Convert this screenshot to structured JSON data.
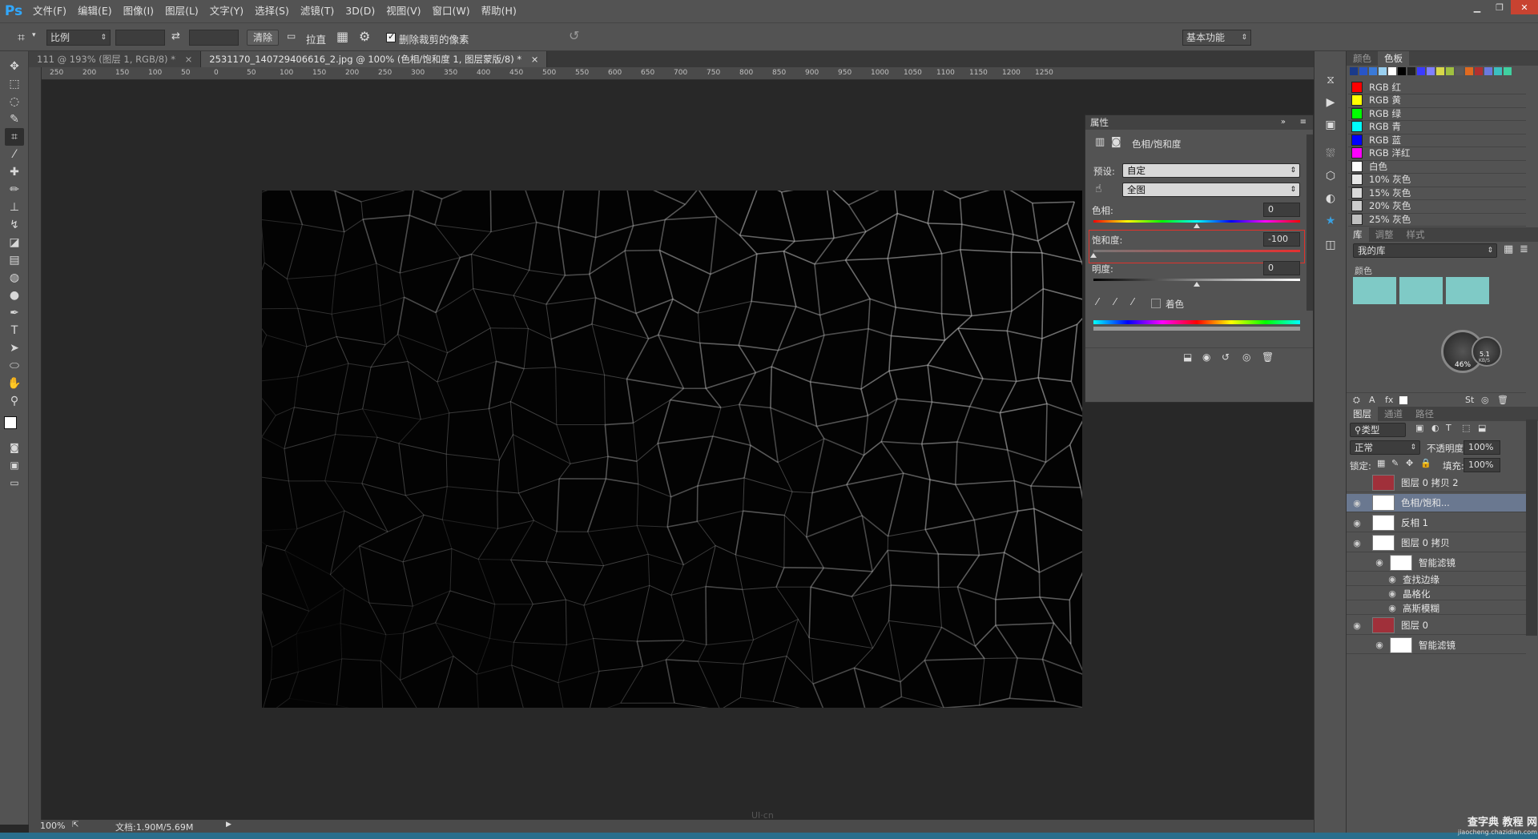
{
  "app": {
    "logo": "Ps"
  },
  "menu": [
    "文件(F)",
    "编辑(E)",
    "图像(I)",
    "图层(L)",
    "文字(Y)",
    "选择(S)",
    "滤镜(T)",
    "3D(D)",
    "视图(V)",
    "窗口(W)",
    "帮助(H)"
  ],
  "window_controls": {
    "minimize": "▁",
    "restore": "❐",
    "close": "✕"
  },
  "options_bar": {
    "ratio_select": "比例",
    "clear_button": "清除",
    "straighten_label": "拉直",
    "delete_cropped_label": "删除裁剪的像素",
    "workspace": "基本功能"
  },
  "tabs": [
    {
      "label": "111 @ 193% (图层 1, RGB/8) *",
      "close": "×"
    },
    {
      "label": "2531170_140729406616_2.jpg @ 100% (色相/饱和度 1, 图层蒙版/8) *",
      "close": "×"
    }
  ],
  "ruler_top_ticks": [
    "250",
    "200",
    "150",
    "100",
    "50",
    "0",
    "50",
    "100",
    "150",
    "200",
    "250",
    "300",
    "350",
    "400",
    "450",
    "500",
    "550",
    "600",
    "650",
    "700",
    "750",
    "800",
    "850",
    "900",
    "950",
    "1000",
    "1050",
    "1100",
    "1150",
    "1200",
    "1250"
  ],
  "properties": {
    "tab": "属性",
    "title": "色相/饱和度",
    "preset_label": "预设:",
    "preset_value": "自定",
    "range_value": "全图",
    "hue_label": "色相:",
    "hue_value": "0",
    "saturation_label": "饱和度:",
    "saturation_value": "-100",
    "lightness_label": "明度:",
    "lightness_value": "0",
    "colorize_label": "着色",
    "hue_fraction": 0.5,
    "saturation_fraction": 0.0,
    "lightness_fraction": 0.5
  },
  "status": {
    "zoom": "100%",
    "doc": "文档:1.90M/5.69M"
  },
  "swatches_panel": {
    "tabs": [
      "颜色",
      "色板"
    ],
    "items": [
      {
        "label": "RGB 红",
        "color": "#ff0000"
      },
      {
        "label": "RGB 黄",
        "color": "#ffff00"
      },
      {
        "label": "RGB 绿",
        "color": "#00ff00"
      },
      {
        "label": "RGB 青",
        "color": "#00ffff"
      },
      {
        "label": "RGB 蓝",
        "color": "#0000ff"
      },
      {
        "label": "RGB 洋红",
        "color": "#ff00ff"
      },
      {
        "label": "白色",
        "color": "#ffffff"
      },
      {
        "label": "10% 灰色",
        "color": "#e6e6e6"
      },
      {
        "label": "15% 灰色",
        "color": "#d9d9d9"
      },
      {
        "label": "20% 灰色",
        "color": "#cccccc"
      },
      {
        "label": "25% 灰色",
        "color": "#bfbfbf"
      }
    ]
  },
  "library_panel": {
    "tabs": [
      "库",
      "调整",
      "样式"
    ],
    "library_select": "我的库",
    "colors_label": "颜色",
    "color": "#7fcac6"
  },
  "gauge": {
    "percent": "46%",
    "speed": "5.1",
    "unit": "KB/S"
  },
  "layers_panel": {
    "tabs": [
      "图层",
      "通道",
      "路径"
    ],
    "filter": "类型",
    "blend_mode": "正常",
    "opacity_label": "不透明度:",
    "opacity_value": "100%",
    "lock_label": "锁定:",
    "fill_label": "填充:",
    "fill_value": "100%",
    "layers": [
      {
        "name": "图层 0 拷贝 2",
        "visible": false,
        "selected": false
      },
      {
        "name": "色相/饱和...",
        "visible": true,
        "selected": true
      },
      {
        "name": "反相 1",
        "visible": true,
        "selected": false
      },
      {
        "name": "图层 0 拷贝",
        "visible": true,
        "selected": false
      },
      {
        "name": "智能滤镜",
        "visible": true,
        "selected": false,
        "sub": true
      },
      {
        "name": "查找边缘",
        "visible": true,
        "selected": false,
        "filter": true
      },
      {
        "name": "晶格化",
        "visible": true,
        "selected": false,
        "filter": true
      },
      {
        "name": "高斯模糊",
        "visible": true,
        "selected": false,
        "filter": true
      },
      {
        "name": "图层 0",
        "visible": true,
        "selected": false
      },
      {
        "name": "智能滤镜",
        "visible": true,
        "selected": false,
        "sub": true
      }
    ]
  },
  "watermark": {
    "line1": "查字典 教程 网",
    "line2": "jiaocheng.chazidian.com",
    "center": "UI·cn"
  }
}
